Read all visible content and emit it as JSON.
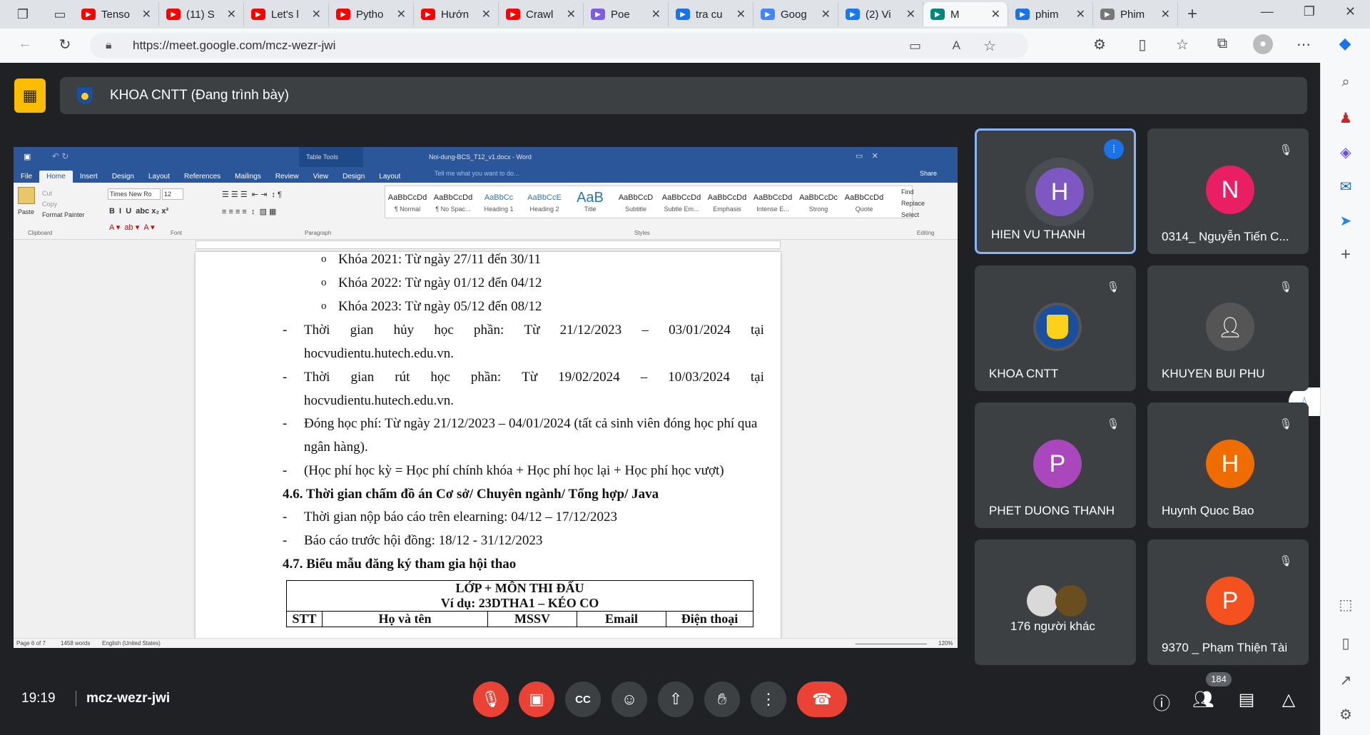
{
  "browser": {
    "tabs": [
      {
        "label": "Tenso",
        "icon": "youtube-icon",
        "color": "#ff0000"
      },
      {
        "label": "(11) S",
        "icon": "youtube-icon",
        "color": "#ff0000"
      },
      {
        "label": "Let's l",
        "icon": "youtube-icon",
        "color": "#ff0000"
      },
      {
        "label": "Pytho",
        "icon": "youtube-icon",
        "color": "#ff0000"
      },
      {
        "label": "Hướn",
        "icon": "youtube-icon",
        "color": "#ff0000"
      },
      {
        "label": "Crawl",
        "icon": "youtube-icon",
        "color": "#ff0000"
      },
      {
        "label": "Poe",
        "icon": "poe-icon",
        "color": "#7c5ce0"
      },
      {
        "label": "tra cu",
        "icon": "search-icon",
        "color": "#1a73e8"
      },
      {
        "label": "Goog",
        "icon": "translate-icon",
        "color": "#4285f4"
      },
      {
        "label": "(2) Vi",
        "icon": "facebook-icon",
        "color": "#1877f2"
      },
      {
        "label": "M",
        "icon": "meet-icon",
        "color": "#00897b"
      },
      {
        "label": "phim",
        "icon": "search-icon",
        "color": "#1a73e8"
      },
      {
        "label": "Phim",
        "icon": "page-icon",
        "color": "#777777"
      }
    ],
    "url": "https://meet.google.com/mcz-wezr-jwi"
  },
  "meet": {
    "presenting_title": "KHOA CNTT (Đang trình bày)",
    "time": "19:19",
    "meeting_code": "mcz-wezr-jwi",
    "participant_count": "184",
    "participants": [
      {
        "name": "HIEN VU THANH",
        "initial": "H",
        "color": "#7e57c2",
        "speaking": true
      },
      {
        "name": "0314_ Nguyễn Tiến C...",
        "initial": "N",
        "color": "#e91e63"
      },
      {
        "name": "KHOA CNTT",
        "initial": "",
        "color": "#1a4fa0"
      },
      {
        "name": "KHUYEN BUI PHU",
        "initial": "",
        "color": "#555555"
      },
      {
        "name": "PHET DUONG THANH",
        "initial": "P",
        "color": "#ab47bc"
      },
      {
        "name": "Huynh Quoc Bao",
        "initial": "H",
        "color": "#ef6c00"
      },
      {
        "name": "176 người khác",
        "initial": "",
        "color": "#3c4043"
      },
      {
        "name": "9370 _ Phạm Thiện Tài",
        "initial": "P",
        "color": "#f4511e"
      }
    ]
  },
  "word": {
    "title": "Noi-dung-BCS_T12_v1.docx - Word",
    "table_tools": "Table Tools",
    "tell_me": "Tell me what you want to do...",
    "share": "Share",
    "tabs": [
      "File",
      "Home",
      "Insert",
      "Design",
      "Layout",
      "References",
      "Mailings",
      "Review",
      "View",
      "Design",
      "Layout"
    ],
    "font_name": "Times New Ro",
    "font_size": "12",
    "clipboard": {
      "paste": "Paste",
      "cut": "Cut",
      "copy": "Copy",
      "painter": "Format Painter"
    },
    "editing": {
      "find": "Find",
      "replace": "Replace",
      "select": "Select"
    },
    "groups": [
      "Clipboard",
      "Font",
      "Paragraph",
      "Styles",
      "Editing"
    ],
    "styles": [
      {
        "preview": "AaBbCcDd",
        "name": "¶ Normal"
      },
      {
        "preview": "AaBbCcDd",
        "name": "¶ No Spac..."
      },
      {
        "preview": "AaBbCc",
        "name": "Heading 1"
      },
      {
        "preview": "AaBbCcE",
        "name": "Heading 2"
      },
      {
        "preview": "AaB",
        "name": "Title"
      },
      {
        "preview": "AaBbCcD",
        "name": "Subtitle"
      },
      {
        "preview": "AaBbCcDd",
        "name": "Subtle Em..."
      },
      {
        "preview": "AaBbCcDd",
        "name": "Emphasis"
      },
      {
        "preview": "AaBbCcDd",
        "name": "Intense E..."
      },
      {
        "preview": "AaBbCcDc",
        "name": "Strong"
      },
      {
        "preview": "AaBbCcDd",
        "name": "Quote"
      }
    ],
    "status": {
      "page": "Page 6 of 7",
      "words": "1458 words",
      "lang": "English (United States)",
      "zoom": "120%"
    },
    "doc": {
      "sub1": "Khóa 2021: Từ ngày 27/11 đến 30/11",
      "sub2": "Khóa 2022: Từ ngày 01/12 đến 04/12",
      "sub3": "Khóa 2023: Từ ngày 05/12 đến 08/12",
      "huy": [
        "Thời",
        "gian",
        "hủy",
        "học",
        "phần:",
        "Từ",
        "21/12/2023",
        "–",
        "03/01/2024",
        "tại"
      ],
      "huy2": "hocvudientu.hutech.edu.vn.",
      "rut": [
        "Thời",
        "gian",
        "rút",
        "học",
        "phần:",
        "Từ",
        "19/02/2024",
        "–",
        "10/03/2024",
        "tại"
      ],
      "rut2": "hocvudientu.hutech.edu.vn.",
      "dong": "Đóng học phí: Từ ngày 21/12/2023 – 04/01/2024 (tất cả sinh viên đóng học phí qua",
      "dong2": "ngân hàng).",
      "hocphi": "(Học phí học kỳ = Học phí chính khóa + Học phí học lại + Học phí học vượt)",
      "h46": "4.6. Thời gian chấm đồ án Cơ sở/ Chuyên ngành/ Tổng hợp/ Java",
      "nop": "Thời gian nộp báo cáo trên elearning: 04/12 – 17/12/2023",
      "baocao": "Báo cáo trước hội đồng: 18/12 - 31/12/2023",
      "h47": "4.7. Biểu mẫu đăng ký tham gia hội thao",
      "table_title": "LỚP + MÔN THI ĐẤU",
      "table_example": "Ví dụ: 23DTHA1 – KÉO CO",
      "columns": [
        "STT",
        "Họ và tên",
        "MSSV",
        "Email",
        "Điện thoại"
      ]
    }
  }
}
